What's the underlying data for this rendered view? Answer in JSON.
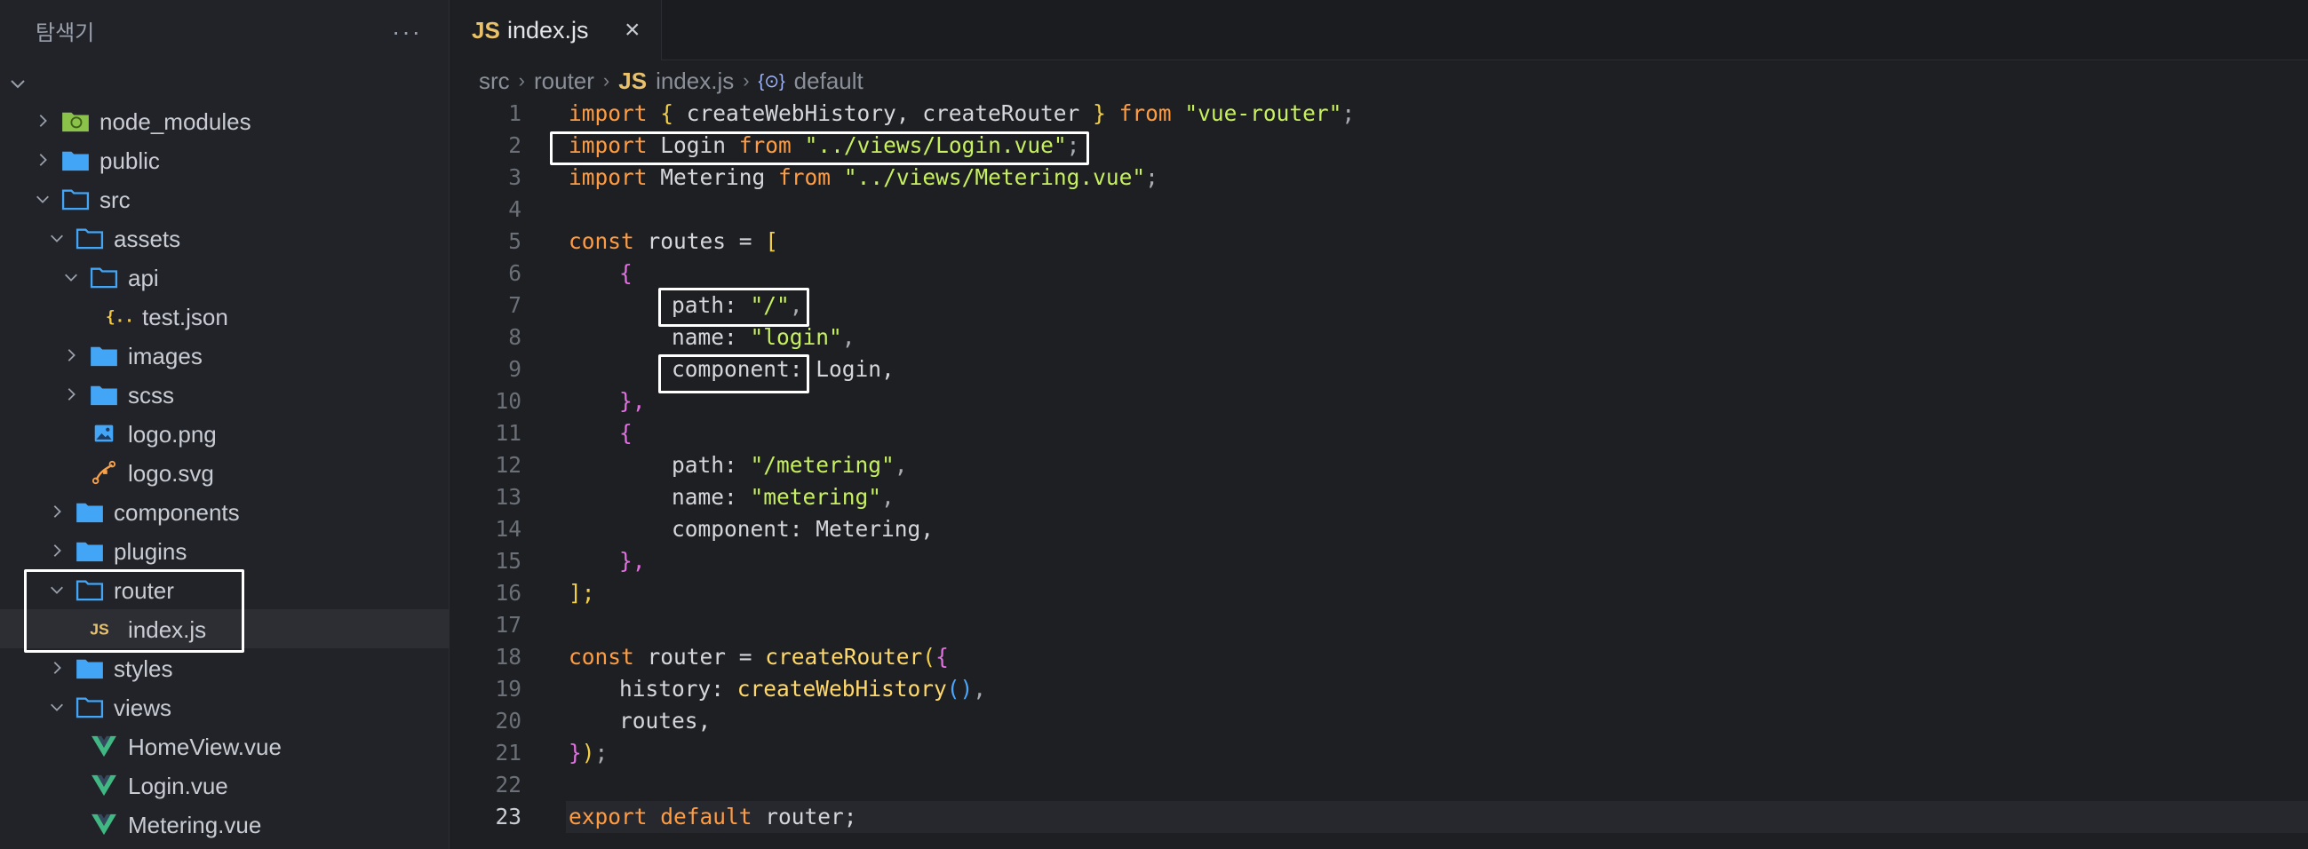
{
  "sidebar": {
    "title": "탐색기",
    "more_label": "···",
    "items": [
      {
        "label": "node_modules",
        "icon": "node-modules-folder-icon"
      },
      {
        "label": "public",
        "icon": "folder-icon"
      },
      {
        "label": "src",
        "icon": "folder-open-icon"
      },
      {
        "label": "assets",
        "icon": "folder-open-icon"
      },
      {
        "label": "api",
        "icon": "folder-open-icon"
      },
      {
        "label": "test.json",
        "icon": "json-file-icon"
      },
      {
        "label": "images",
        "icon": "folder-icon"
      },
      {
        "label": "scss",
        "icon": "folder-icon"
      },
      {
        "label": "logo.png",
        "icon": "image-file-icon"
      },
      {
        "label": "logo.svg",
        "icon": "svg-file-icon"
      },
      {
        "label": "components",
        "icon": "folder-icon"
      },
      {
        "label": "plugins",
        "icon": "folder-icon"
      },
      {
        "label": "router",
        "icon": "folder-open-icon"
      },
      {
        "label": "index.js",
        "icon": "js-file-icon"
      },
      {
        "label": "styles",
        "icon": "folder-icon"
      },
      {
        "label": "views",
        "icon": "folder-open-icon"
      },
      {
        "label": "HomeView.vue",
        "icon": "vue-file-icon"
      },
      {
        "label": "Login.vue",
        "icon": "vue-file-icon"
      },
      {
        "label": "Metering.vue",
        "icon": "vue-file-icon"
      }
    ]
  },
  "tab": {
    "js_badge": "JS",
    "name": "index.js",
    "close": "×"
  },
  "breadcrumb": {
    "p1": "src",
    "p2": "router",
    "js_badge": "JS",
    "p3": "index.js",
    "symbol_icon": "{⊙}",
    "p4": "default"
  },
  "code": {
    "line_numbers": [
      "1",
      "2",
      "3",
      "4",
      "5",
      "6",
      "7",
      "8",
      "9",
      "10",
      "11",
      "12",
      "13",
      "14",
      "15",
      "16",
      "17",
      "18",
      "19",
      "20",
      "21",
      "22",
      "23"
    ],
    "t": {
      "import": "import",
      "from": "from",
      "const": "const",
      "export": "export",
      "default": "default",
      "lbrace": "{",
      "rbrace": "}",
      "lbrack": "[",
      "rbrack": "];",
      "l1_mid": " createWebHistory, createRouter ",
      "l1_str": "\"vue-router\"",
      "semi": ";",
      "l2_mid": " Login ",
      "l2_str": "\"../views/Login.vue\"",
      "l3_mid": " Metering ",
      "l3_str": "\"../views/Metering.vue\"",
      "routes_decl": " routes = ",
      "path_key": "path: ",
      "name_key": "name: ",
      "component_key": "component: ",
      "root_path": "\"/\"",
      "login_name": "\"login\"",
      "comma": ",",
      "login_comp": "Login,",
      "close_obj": "},",
      "metering_path": "\"/metering\"",
      "metering_name": "\"metering\"",
      "metering_comp": "Metering,",
      "router_decl": " router = ",
      "createRouter": "createRouter",
      "lparen": "(",
      "history_key": "history: ",
      "createWebHistory": "createWebHistory",
      "parens": "()",
      "routes_line": "routes,",
      "close_call_a": "}",
      "close_call_b": ")",
      "router_ref": " router;"
    }
  }
}
